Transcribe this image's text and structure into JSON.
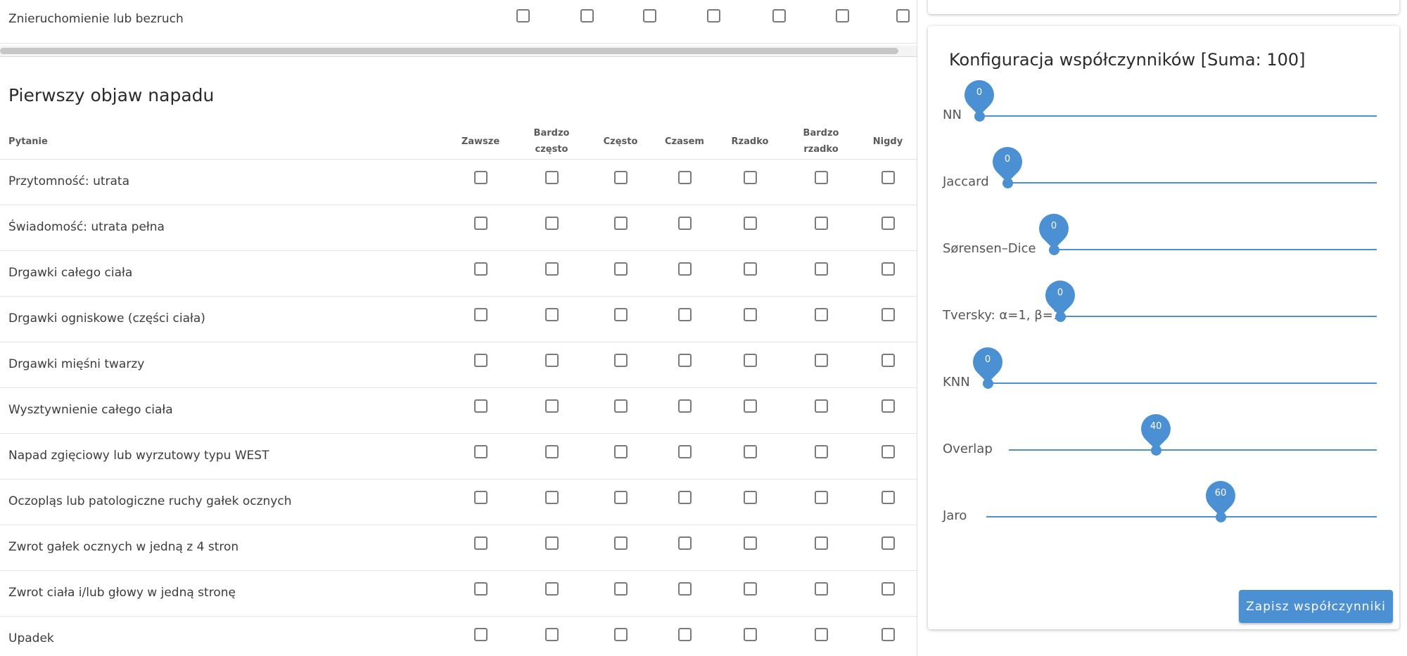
{
  "previous_section": {
    "last_question": "Znieruchomienie lub bezruch"
  },
  "section": {
    "title": "Pierwszy objaw napadu",
    "column_question": "Pytanie",
    "columns": [
      "Zawsze",
      "Bardzo często",
      "Często",
      "Czasem",
      "Rzadko",
      "Bardzo rzadko",
      "Nigdy"
    ],
    "questions": [
      "Przytomność: utrata",
      "Świadomość: utrata pełna",
      "Drgawki całego ciała",
      "Drgawki ogniskowe (części ciała)",
      "Drgawki mięśni twarzy",
      "Wysztywnienie całego ciała",
      "Napad zgięciowy lub wyrzutowy typu WEST",
      "Oczopląs lub patologiczne ruchy gałek ocznych",
      "Zwrot gałek ocznych w jedną z 4 stron",
      "Zwrot ciała i/lub głowy w jedną stronę",
      "Upadek"
    ]
  },
  "config": {
    "title": "Konfiguracja współczynników [Suma: 100]",
    "sliders": [
      {
        "label": "NN",
        "value": 0
      },
      {
        "label": "Jaccard",
        "value": 0
      },
      {
        "label": "Sørensen–Dice",
        "value": 0
      },
      {
        "label": "Tversky: α=1, β=1",
        "value": 0
      },
      {
        "label": "KNN",
        "value": 0
      },
      {
        "label": "Overlap",
        "value": 40
      },
      {
        "label": "Jaro",
        "value": 60
      }
    ],
    "slider_max": 100,
    "save_label": "Zapisz współczynniki"
  },
  "colors": {
    "accent": "#4a90d2"
  }
}
